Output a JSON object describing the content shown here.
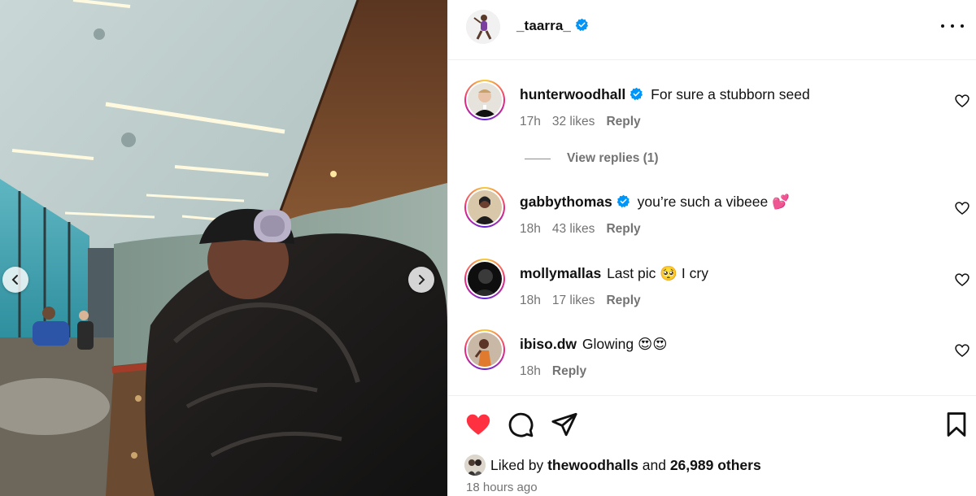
{
  "post": {
    "author": "_taarra_",
    "verified": true
  },
  "comments": [
    {
      "user": "hunterwoodhall",
      "verified": true,
      "text": "For sure a stubborn seed",
      "age": "17h",
      "likes": "32 likes",
      "reply": "Reply"
    },
    {
      "user": "gabbythomas",
      "verified": true,
      "text": "you’re such a vibeee 💕",
      "age": "18h",
      "likes": "43 likes",
      "reply": "Reply"
    },
    {
      "user": "mollymallas",
      "verified": false,
      "text": "Last pic 🥺 I cry",
      "age": "18h",
      "likes": "17 likes",
      "reply": "Reply"
    },
    {
      "user": "ibiso.dw",
      "verified": false,
      "text": "Glowing 😍😍",
      "age": "18h",
      "reply": "Reply"
    }
  ],
  "view_replies": "View replies (1)",
  "likes": {
    "prefix": "Liked by",
    "user": "thewoodhalls",
    "and": "and",
    "others": "26,989 others"
  },
  "timestamp": "18 hours ago",
  "colors": {
    "liked_heart": "#ff3040",
    "verified_blue": "#0095f6",
    "meta_gray": "#737373"
  },
  "icons": [
    "chevron-left-icon",
    "chevron-right-icon",
    "verified-badge-icon",
    "more-options-icon",
    "heart-outline-icon",
    "heart-filled-icon",
    "comment-icon",
    "share-icon",
    "bookmark-icon"
  ]
}
